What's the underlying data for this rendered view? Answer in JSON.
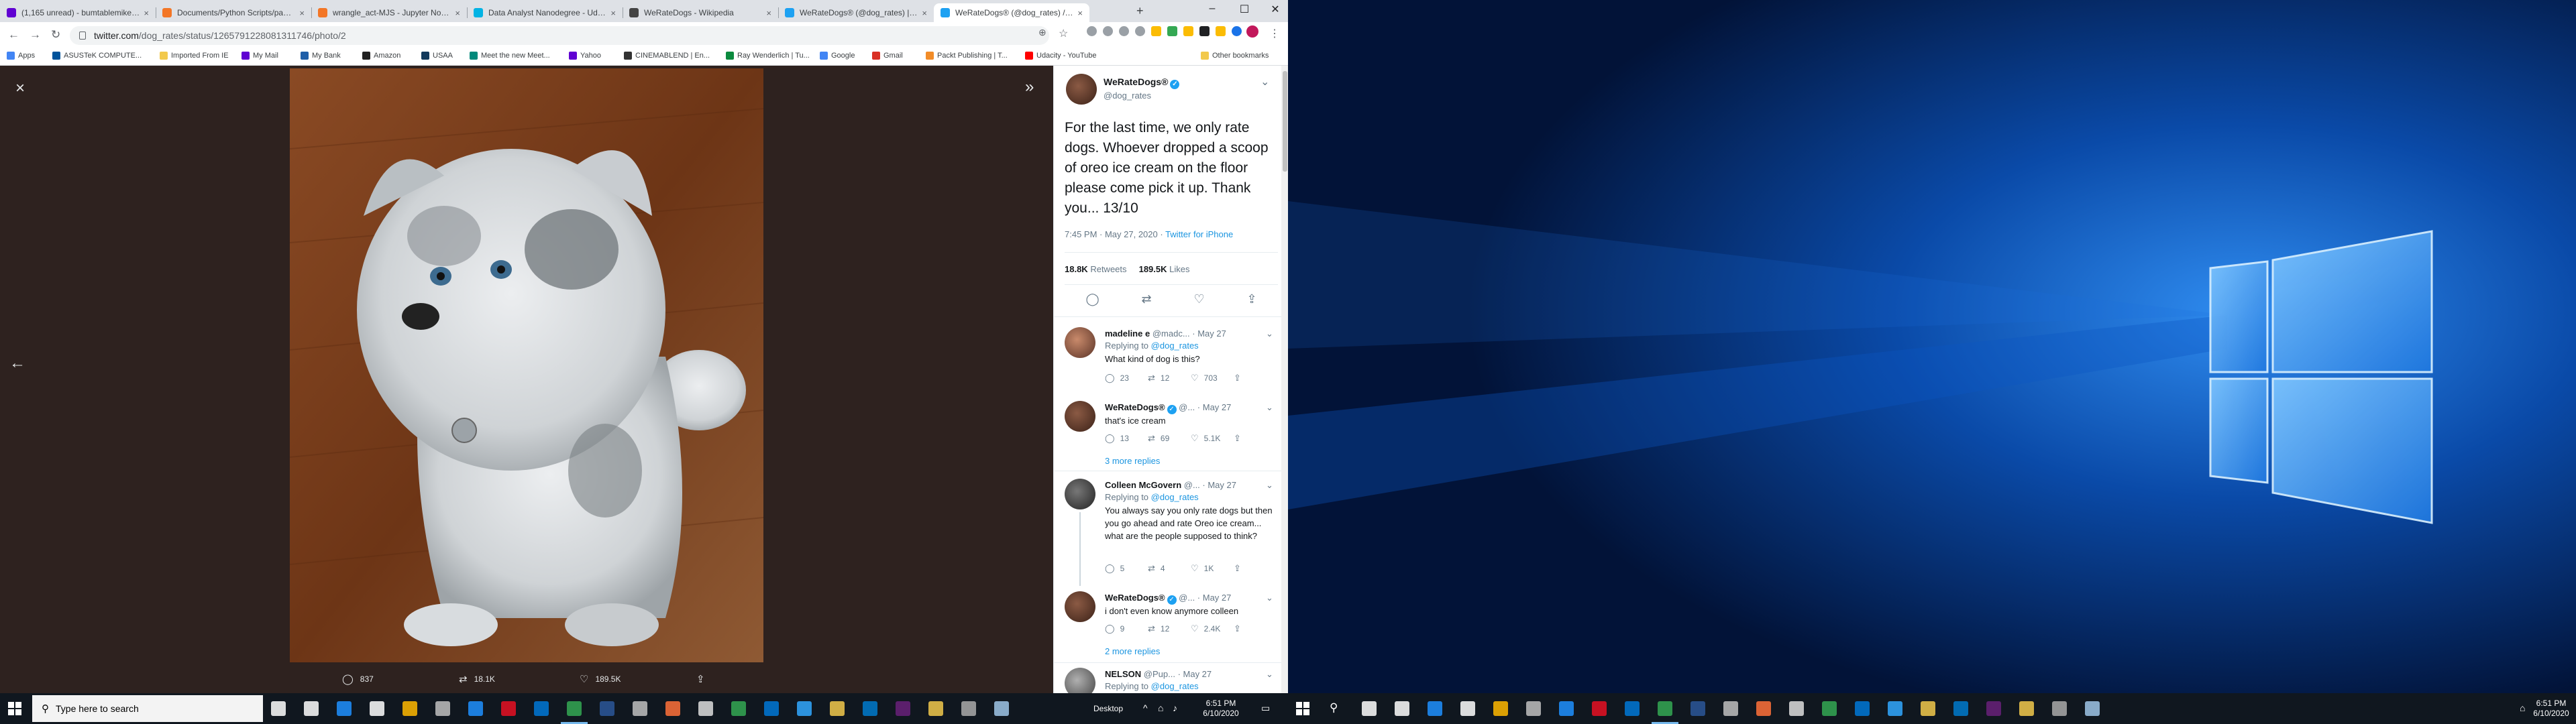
{
  "browser": {
    "tabs": [
      {
        "title": "(1,165 unread) - bumtablemike@...",
        "color": "#6001d2"
      },
      {
        "title": "Documents/Python Scripts/panda...",
        "color": "#f37626"
      },
      {
        "title": "wrangle_act-MJS - Jupyter Notebo...",
        "color": "#f37626"
      },
      {
        "title": "Data Analyst Nanodegree - Udacit...",
        "color": "#02b3e4"
      },
      {
        "title": "WeRateDogs - Wikipedia",
        "color": "#444444"
      },
      {
        "title": "WeRateDogs® (@dog_rates) | Twit...",
        "color": "#1da1f2"
      },
      {
        "title": "WeRateDogs® (@dog_rates) / Twit...",
        "color": "#1da1f2"
      }
    ],
    "new_tab": "+",
    "url_host": "twitter.com",
    "url_path": "/dog_rates/status/1265791228081311746/photo/2",
    "bookmarks": [
      {
        "label": "Apps",
        "color": "#4285f4"
      },
      {
        "label": "ASUSTeK COMPUTE...",
        "color": "#00539b"
      },
      {
        "label": "Imported From IE",
        "color": "#f2c94c"
      },
      {
        "label": "My Mail",
        "color": "#6001d2"
      },
      {
        "label": "My Bank",
        "color": "#1f5fa8"
      },
      {
        "label": "Amazon",
        "color": "#222222"
      },
      {
        "label": "USAA",
        "color": "#12395b"
      },
      {
        "label": "Meet the new Meet...",
        "color": "#00897b"
      },
      {
        "label": "Yahoo",
        "color": "#6001d2"
      },
      {
        "label": "CINEMABLEND | En...",
        "color": "#333333"
      },
      {
        "label": "Ray Wenderlich | Tu...",
        "color": "#0b8a3e"
      },
      {
        "label": "Google",
        "color": "#4285f4"
      },
      {
        "label": "Gmail",
        "color": "#d93025"
      },
      {
        "label": "Packt Publishing | T...",
        "color": "#f28c28"
      },
      {
        "label": "Udacity - YouTube",
        "color": "#ff0000"
      },
      {
        "label": "Other bookmarks",
        "color": "#f2c94c"
      }
    ]
  },
  "photo_modal": {
    "replies_count": "837",
    "retweets_count": "18.1K",
    "likes_count": "189.5K"
  },
  "tweet": {
    "display_name": "WeRateDogs®",
    "handle": "@dog_rates",
    "text": "For the last time, we only rate dogs. Whoever dropped a scoop of oreo ice cream on the floor please come pick it up. Thank you... 13/10",
    "timestamp": "7:45 PM · May 27, 2020 · ",
    "source": "Twitter for iPhone",
    "retweets": "18.8K",
    "retweets_label": "Retweets",
    "likes": "189.5K",
    "likes_label": "Likes"
  },
  "replies": [
    {
      "name": "madeline e",
      "handle": "@madc... · May 27",
      "replying_label": "Replying to ",
      "replying_to": "@dog_rates",
      "text": "What kind of dog is this?",
      "replies": "23",
      "retweets": "12",
      "likes": "703"
    },
    {
      "name": "WeRateDogs®",
      "handle": "@... · May 27",
      "text": "that's ice cream",
      "replies": "13",
      "retweets": "69",
      "likes": "5.1K",
      "more": "3 more replies"
    },
    {
      "name": "Colleen McGovern",
      "handle": "@... · May 27",
      "replying_label": "Replying to ",
      "replying_to": "@dog_rates",
      "text": "You always say you only rate dogs but then you go ahead and rate Oreo ice cream... what are the people supposed to think?",
      "replies": "5",
      "retweets": "4",
      "likes": "1K"
    },
    {
      "name": "WeRateDogs®",
      "handle": "@... · May 27",
      "text": "i don't even know anymore colleen",
      "replies": "9",
      "retweets": "12",
      "likes": "2.4K",
      "more": "2 more replies"
    },
    {
      "name": "NELSON",
      "handle": "@Pup... · May 27",
      "replying_label": "Replying to ",
      "replying_to": "@dog_rates"
    }
  ],
  "taskbar": {
    "search_placeholder": "Type here to search",
    "desktop_label": "Desktop",
    "time": "6:51 PM",
    "date": "6/10/2020",
    "icons": [
      {
        "name": "cortana",
        "color": "#ffffff"
      },
      {
        "name": "task-view",
        "color": "#ffffff"
      },
      {
        "name": "edge",
        "color": "#1e90ff"
      },
      {
        "name": "store",
        "color": "#ffffff"
      },
      {
        "name": "app",
        "color": "#ffb900"
      },
      {
        "name": "tools",
        "color": "#c0c0c0"
      },
      {
        "name": "app",
        "color": "#1e90ff"
      },
      {
        "name": "app",
        "color": "#e81123"
      },
      {
        "name": "mail",
        "color": "#0078d7"
      },
      {
        "name": "chrome",
        "color": "#34a853"
      },
      {
        "name": "word",
        "color": "#2b579a"
      },
      {
        "name": "tools",
        "color": "#c0c0c0"
      },
      {
        "name": "firefox",
        "color": "#ff7139"
      },
      {
        "name": "app",
        "color": "#dddddd"
      },
      {
        "name": "app",
        "color": "#34a853"
      },
      {
        "name": "app",
        "color": "#0078d7"
      },
      {
        "name": "photoshop",
        "color": "#31a8ff"
      },
      {
        "name": "app",
        "color": "#f2c94c"
      },
      {
        "name": "vscode",
        "color": "#007acc"
      },
      {
        "name": "app",
        "color": "#68217a"
      },
      {
        "name": "file-explorer",
        "color": "#f2c94c"
      },
      {
        "name": "app",
        "color": "#aaaaaa"
      },
      {
        "name": "app",
        "color": "#9fc5e8"
      }
    ]
  }
}
